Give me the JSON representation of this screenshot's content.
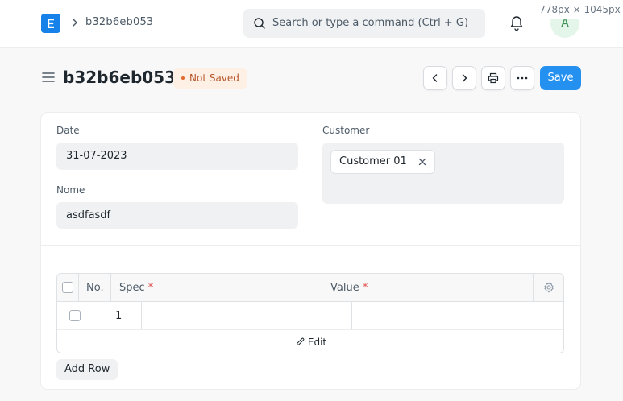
{
  "navbar": {
    "breadcrumb": "b32b6eb053",
    "search_placeholder": "Search or type a command (Ctrl + G)",
    "avatar_initial": "A",
    "screen_badge": "778px × 1045px"
  },
  "header": {
    "title": "b32b6eb053",
    "status": "Not Saved",
    "save_label": "Save"
  },
  "form": {
    "date_label": "Date",
    "date_value": "31-07-2023",
    "nome_label": "Nome",
    "nome_value": "asdfasdf",
    "customer_label": "Customer",
    "customer_value": "Customer 01"
  },
  "grid": {
    "col_no": "No.",
    "col_spec": "Spec",
    "col_value": "Value",
    "required_mark": "*",
    "rows": [
      {
        "idx": "1",
        "spec": "",
        "value": ""
      }
    ],
    "edit_label": "Edit",
    "add_row_label": "Add Row"
  },
  "colors": {
    "primary": "#2490ef",
    "status_bg": "#fff0e6",
    "status_text": "#b5562a"
  },
  "icons": [
    "app-logo-icon",
    "chevron-right-icon",
    "search-icon",
    "bell-icon",
    "hamburger-icon",
    "chevron-left-icon",
    "printer-icon",
    "more-icon",
    "close-icon",
    "settings-icon",
    "pencil-icon"
  ]
}
